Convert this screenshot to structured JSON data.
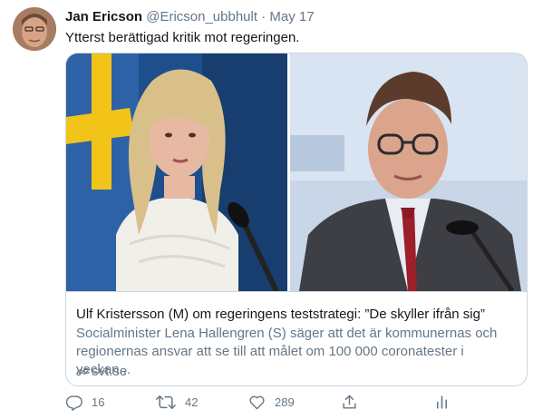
{
  "tweet": {
    "author_name": "Jan Ericson",
    "author_handle": "@Ericson_ubbhult",
    "separator": "·",
    "date": "May 17",
    "text": "Ytterst berättigad kritik mot regeringen."
  },
  "card": {
    "title": "Ulf Kristersson (M) om regeringens teststrategi: ”De skyller ifrån sig”",
    "description": "Socialminister Lena Hallengren (S) säger att det är kommunernas och regionernas ansvar att se till att målet om 100 000 coronatester i veckan...",
    "domain": "svt.se"
  },
  "actions": {
    "reply_count": "16",
    "retweet_count": "42",
    "like_count": "289"
  },
  "icons": {
    "reply": "reply-icon",
    "retweet": "retweet-icon",
    "like": "heart-icon",
    "share": "share-icon",
    "analytics": "analytics-icon",
    "link": "link-icon"
  },
  "colors": {
    "text": "#14171a",
    "secondary": "#657786",
    "border": "#ccd6dd"
  }
}
